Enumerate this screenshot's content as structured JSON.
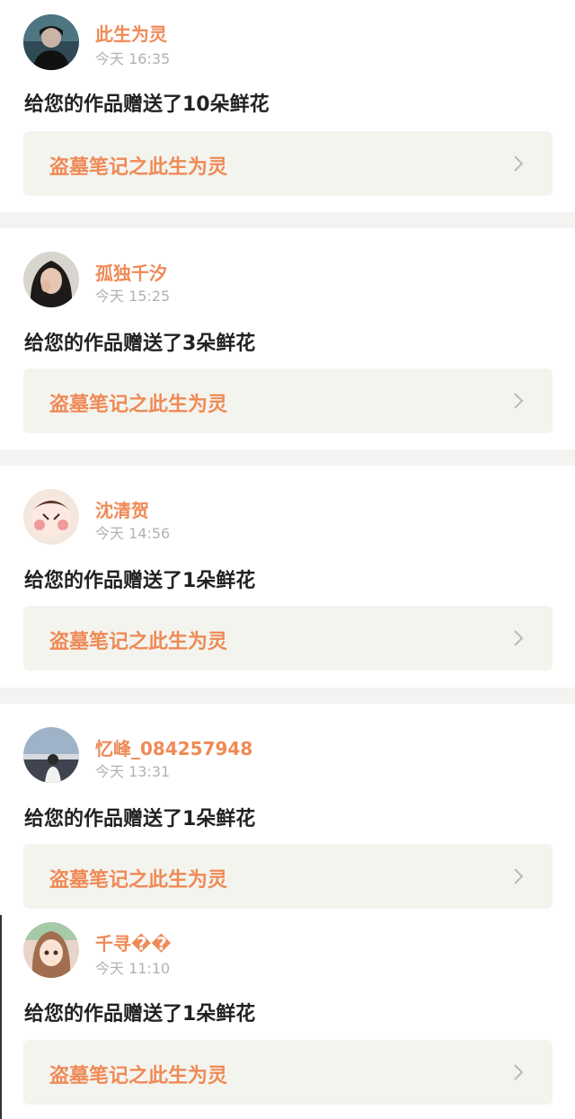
{
  "notifications": [
    {
      "username": "此生为灵",
      "time": "今天 16:35",
      "message": "给您的作品赠送了10朵鲜花",
      "work_title": "盗墓笔记之此生为灵",
      "avatar_icon": "user-avatar-icon"
    },
    {
      "username": "孤独千汐",
      "time": "今天 15:25",
      "message": "给您的作品赠送了3朵鲜花",
      "work_title": "盗墓笔记之此生为灵",
      "avatar_icon": "user-avatar-icon"
    },
    {
      "username": "沈清贺",
      "time": "今天 14:56",
      "message": "给您的作品赠送了1朵鲜花",
      "work_title": "盗墓笔记之此生为灵",
      "avatar_icon": "user-avatar-icon"
    },
    {
      "username": "忆峰_084257948",
      "time": "今天 13:31",
      "message": "给您的作品赠送了1朵鲜花",
      "work_title": "盗墓笔记之此生为灵",
      "avatar_icon": "user-avatar-icon"
    },
    {
      "username": "千寻��",
      "time": "今天 11:10",
      "message": "给您的作品赠送了1朵鲜花",
      "work_title": "盗墓笔记之此生为灵",
      "avatar_icon": "user-avatar-icon"
    }
  ],
  "colors": {
    "accent": "#ef8a56",
    "message_text": "#222222",
    "time_text": "#b2b2b2",
    "link_bg": "#f4f4ef",
    "separator": "#f3f3f1"
  }
}
